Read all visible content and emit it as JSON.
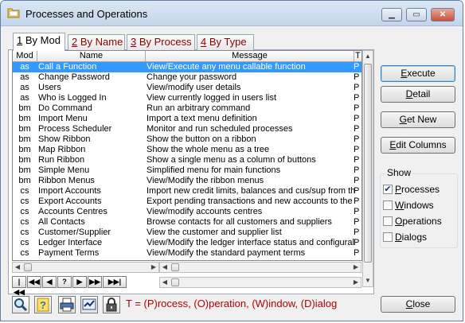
{
  "window": {
    "title": "Processes and Operations"
  },
  "tabs": [
    {
      "key": "1",
      "label": " By Mod"
    },
    {
      "key": "2",
      "label": " By Name"
    },
    {
      "key": "3",
      "label": " By Process"
    },
    {
      "key": "4",
      "label": " By Type"
    }
  ],
  "grid": {
    "headers": {
      "mod": "Mod",
      "name": "Name",
      "message": "Message",
      "t": "T"
    },
    "rows": [
      {
        "mod": "as",
        "name": "Call a Function",
        "message": "View/Execute any menu callable function",
        "t": "P",
        "selected": true
      },
      {
        "mod": "as",
        "name": "Change Password",
        "message": "Change your password",
        "t": "P"
      },
      {
        "mod": "as",
        "name": "Users",
        "message": "View/modify user details",
        "t": "P"
      },
      {
        "mod": "as",
        "name": "Who is Logged In",
        "message": "View currently logged in users list",
        "t": "P"
      },
      {
        "mod": "bm",
        "name": "Do Command",
        "message": "Run an arbitrary command",
        "t": "P"
      },
      {
        "mod": "bm",
        "name": "Import Menu",
        "message": "Import a text menu definition",
        "t": "P"
      },
      {
        "mod": "bm",
        "name": "Process Scheduler",
        "message": "Monitor and run scheduled processes",
        "t": "P"
      },
      {
        "mod": "bm",
        "name": "Show Ribbon",
        "message": "Show the button on a ribbon",
        "t": "P"
      },
      {
        "mod": "bm",
        "name": "Map Ribbon",
        "message": "Show the whole menu as a tree",
        "t": "P"
      },
      {
        "mod": "bm",
        "name": "Run Ribbon",
        "message": "Show a single menu as a column of buttons",
        "t": "P"
      },
      {
        "mod": "bm",
        "name": "Simple Menu",
        "message": "Simplified menu for main functions",
        "t": "P"
      },
      {
        "mod": "bm",
        "name": "Ribbon Menus",
        "message": "View/Modify the ribbon menus",
        "t": "P"
      },
      {
        "mod": "cs",
        "name": "Import Accounts",
        "message": "Import new credit limits, balances and cus/sup from th",
        "t": "P"
      },
      {
        "mod": "cs",
        "name": "Export Accounts",
        "message": "Export pending transactions and new accounts to the",
        "t": "P"
      },
      {
        "mod": "cs",
        "name": "Accounts Centres",
        "message": "View/modify accounts centres",
        "t": "P"
      },
      {
        "mod": "cs",
        "name": "All Contacts",
        "message": "Browse contacts for all customers and suppliers",
        "t": "P"
      },
      {
        "mod": "cs",
        "name": "Customer/Supplier",
        "message": "View the customer and supplier list",
        "t": "P"
      },
      {
        "mod": "cs",
        "name": "Ledger Interface",
        "message": "View/Modify the ledger interface status and configural",
        "t": "P"
      },
      {
        "mod": "cs",
        "name": "Payment Terms",
        "message": "View/Modify the standard payment terms",
        "t": "P"
      }
    ]
  },
  "nav": {
    "first": "|◀◀",
    "prev_page": "◀◀",
    "prev": "◀",
    "find": "?",
    "next": "▶",
    "next_page": "▶▶",
    "last": "▶▶|"
  },
  "buttons": {
    "execute": {
      "ul": "E",
      "rest": "xecute"
    },
    "detail": {
      "ul": "D",
      "rest": "etail"
    },
    "get_new": {
      "ul": "G",
      "rest": "et New"
    },
    "edit_columns": {
      "ul": "E",
      "rest": "dit Columns"
    },
    "close": {
      "ul": "C",
      "rest": "lose"
    }
  },
  "show": {
    "title": "Show",
    "options": [
      {
        "ul": "P",
        "rest": "rocesses",
        "checked": true
      },
      {
        "ul": "W",
        "rest": "indows",
        "checked": false
      },
      {
        "ul": "O",
        "rest": "perations",
        "checked": false
      },
      {
        "ul": "D",
        "rest": "ialogs",
        "checked": false
      }
    ]
  },
  "toolbar": {
    "icons": [
      "search-icon",
      "help-icon",
      "print-icon",
      "export-icon",
      "lock-icon"
    ]
  },
  "legend": "T = (P)rocess, (O)peration, (W)indow, (D)ialog",
  "colors": {
    "selection": "#3399ff",
    "legend": "#b00000",
    "tab_text": "#8b0000"
  }
}
